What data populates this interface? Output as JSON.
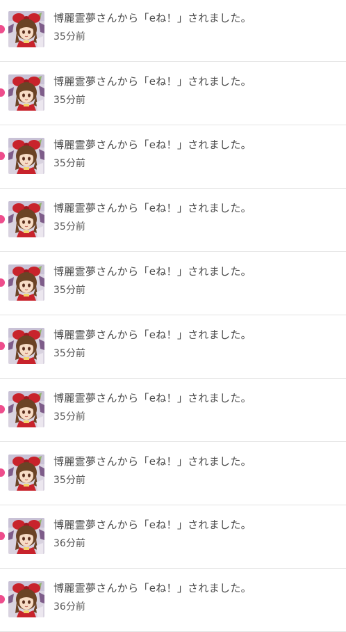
{
  "colors": {
    "unread_dot": "#ee4d8c",
    "divider": "#e3e3e3",
    "message_text": "#4a4a4a",
    "time_text": "#555555"
  },
  "notifications": [
    {
      "message": "博麗霊夢さんから「eね！」されました。",
      "time": "35分前",
      "unread": true,
      "avatar_icon": "user-avatar-icon"
    },
    {
      "message": "博麗霊夢さんから「eね！」されました。",
      "time": "35分前",
      "unread": true,
      "avatar_icon": "user-avatar-icon"
    },
    {
      "message": "博麗霊夢さんから「eね！」されました。",
      "time": "35分前",
      "unread": true,
      "avatar_icon": "user-avatar-icon"
    },
    {
      "message": "博麗霊夢さんから「eね！」されました。",
      "time": "35分前",
      "unread": true,
      "avatar_icon": "user-avatar-icon"
    },
    {
      "message": "博麗霊夢さんから「eね！」されました。",
      "time": "35分前",
      "unread": true,
      "avatar_icon": "user-avatar-icon"
    },
    {
      "message": "博麗霊夢さんから「eね！」されました。",
      "time": "35分前",
      "unread": true,
      "avatar_icon": "user-avatar-icon"
    },
    {
      "message": "博麗霊夢さんから「eね！」されました。",
      "time": "35分前",
      "unread": true,
      "avatar_icon": "user-avatar-icon"
    },
    {
      "message": "博麗霊夢さんから「eね！」されました。",
      "time": "35分前",
      "unread": true,
      "avatar_icon": "user-avatar-icon"
    },
    {
      "message": "博麗霊夢さんから「eね！」されました。",
      "time": "36分前",
      "unread": true,
      "avatar_icon": "user-avatar-icon"
    },
    {
      "message": "博麗霊夢さんから「eね！」されました。",
      "time": "36分前",
      "unread": true,
      "avatar_icon": "user-avatar-icon"
    }
  ]
}
